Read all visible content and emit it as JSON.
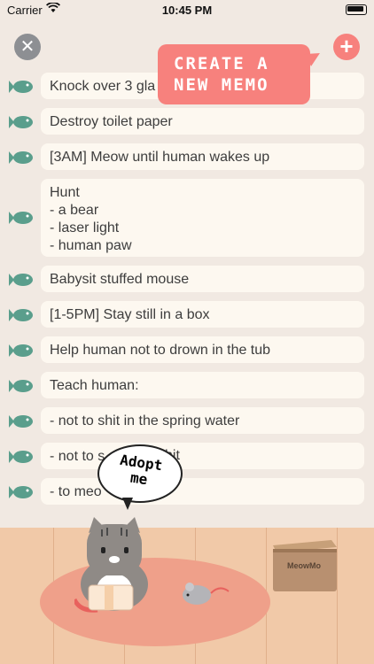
{
  "status_bar": {
    "carrier": "Carrier",
    "time": "10:45 PM"
  },
  "toolbar": {
    "close_icon": "x-icon",
    "add_icon": "plus-icon"
  },
  "tooltip": {
    "line1": "CREATE A",
    "line2": "NEW MEMO"
  },
  "memos": [
    "Knock over 3 gla",
    "Destroy toilet paper",
    "[3AM] Meow until human wakes up",
    "Hunt\n- a bear\n- laser light\n- human paw",
    "Babysit stuffed mouse",
    "[1-5PM] Stay still in a box",
    "Help human not to drown in the tub",
    "Teach human:",
    "- not to shit in the spring water",
    "- not to s",
    "- to meo"
  ],
  "memo_text_tail": "hit",
  "speech": {
    "line1": "Adopt",
    "line2": "me"
  },
  "box_label": "MeowMo",
  "colors": {
    "background": "#f1e9e2",
    "accent": "#f7817d",
    "fish": "#5a9e8c",
    "memo_bubble": "#fdf8f0"
  }
}
